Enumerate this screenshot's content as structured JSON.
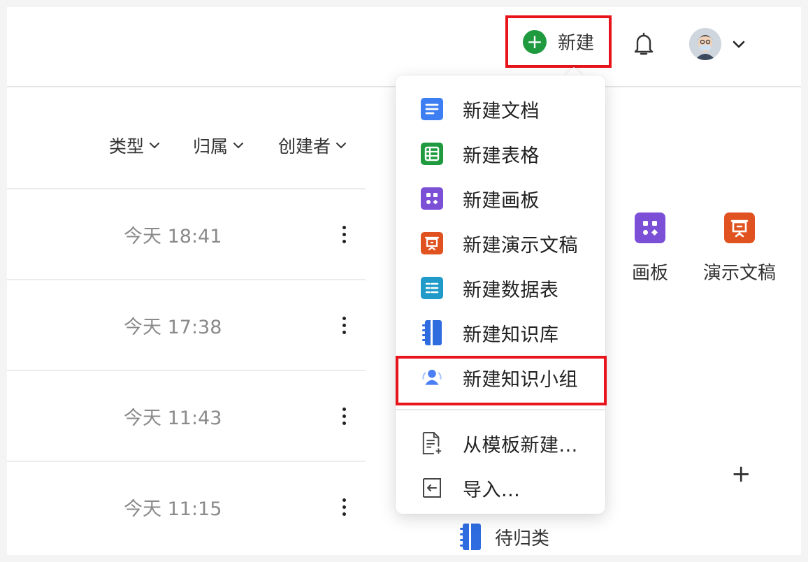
{
  "header": {
    "new_button_label": "新建",
    "icons": [
      "plus-circle-icon",
      "bell-icon",
      "avatar",
      "chevron-down-icon"
    ]
  },
  "filters": [
    {
      "label": "类型"
    },
    {
      "label": "归属"
    },
    {
      "label": "创建者"
    }
  ],
  "rows": [
    {
      "time": "今天 18:41"
    },
    {
      "time": "今天 17:38"
    },
    {
      "time": "今天 11:43"
    },
    {
      "time": "今天 11:15"
    }
  ],
  "type_tiles": [
    {
      "label": "画板",
      "icon": "whiteboard-icon",
      "color": "#7b4fd6"
    },
    {
      "label": "演示文稿",
      "icon": "presentation-icon",
      "color": "#e0521f"
    }
  ],
  "uncategorized_label": "待归类",
  "menu": {
    "items": [
      {
        "label": "新建文档",
        "icon": "doc-icon",
        "color": "#3d7ff2"
      },
      {
        "label": "新建表格",
        "icon": "sheet-icon",
        "color": "#1f9a3f"
      },
      {
        "label": "新建画板",
        "icon": "whiteboard-icon",
        "color": "#7b4fd6"
      },
      {
        "label": "新建演示文稿",
        "icon": "presentation-icon",
        "color": "#e0521f"
      },
      {
        "label": "新建数据表",
        "icon": "datatable-icon",
        "color": "#1f9ac9"
      },
      {
        "label": "新建知识库",
        "icon": "knowledge-base-icon",
        "color": "#2f6ce0"
      },
      {
        "label": "新建知识小组",
        "icon": "group-icon",
        "color": "#4a7ff5"
      }
    ],
    "secondary_items": [
      {
        "label": "从模板新建...",
        "icon": "template-icon"
      },
      {
        "label": "导入...",
        "icon": "import-icon"
      }
    ]
  },
  "colors": {
    "highlight": "#e8141b",
    "new_button_icon": "#1f9a3f"
  }
}
